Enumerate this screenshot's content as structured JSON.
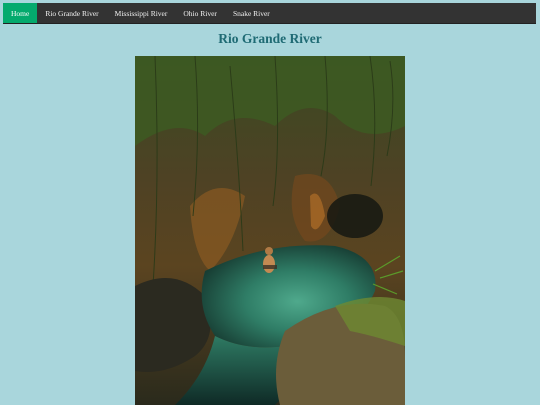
{
  "nav": {
    "items": [
      {
        "label": "Home",
        "active": true
      },
      {
        "label": "Rio Grande River",
        "active": false
      },
      {
        "label": "Mississippi River",
        "active": false
      },
      {
        "label": "Ohio River",
        "active": false
      },
      {
        "label": "Snake River",
        "active": false
      }
    ]
  },
  "page": {
    "title": "Rio Grande River"
  },
  "colors": {
    "background": "#a9d6dc",
    "navbar": "#333333",
    "nav_active": "#04aa6d",
    "title": "#1f6b74"
  }
}
